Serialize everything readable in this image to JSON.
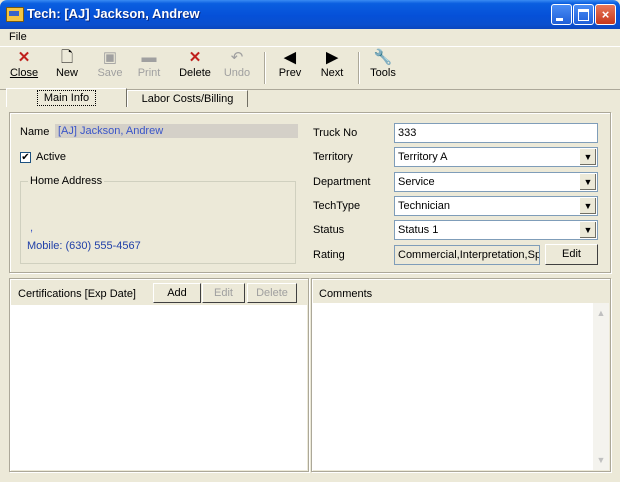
{
  "window": {
    "title": "Tech: [AJ] Jackson, Andrew",
    "caption_buttons": {
      "minimize": "minimize-icon",
      "maximize": "maximize-icon",
      "close": "×"
    }
  },
  "menu": {
    "file": "File"
  },
  "toolbar": {
    "close": {
      "label": "Close",
      "icon": "x-icon",
      "color": "#C0201C",
      "enabled": true
    },
    "new": {
      "label": "New",
      "icon": "document-icon",
      "enabled": true
    },
    "save": {
      "label": "Save",
      "icon": "floppy-icon",
      "enabled": false
    },
    "print": {
      "label": "Print",
      "icon": "printer-icon",
      "enabled": false
    },
    "delete": {
      "label": "Delete",
      "icon": "x-icon",
      "color": "#C0201C",
      "enabled": true
    },
    "undo": {
      "label": "Undo",
      "icon": "undo-icon",
      "enabled": false
    },
    "prev": {
      "label": "Prev",
      "icon": "triangle-left-icon",
      "enabled": true
    },
    "next": {
      "label": "Next",
      "icon": "triangle-right-icon",
      "enabled": true
    },
    "tools": {
      "label": "Tools",
      "icon": "wrench-icon",
      "enabled": true
    }
  },
  "tabs": [
    {
      "label": "Main Info",
      "active": true
    },
    {
      "label": "Labor Costs/Billing",
      "active": false
    }
  ],
  "main": {
    "name_label": "Name",
    "name_value": "[AJ] Jackson, Andrew",
    "active_label": "Active",
    "active_checked": true,
    "check_mark": "✔",
    "home_address_label": "Home Address",
    "address_dot": ",",
    "mobile": "Mobile: (630) 555-4567",
    "truck_label": "Truck No",
    "truck_value": "333",
    "territory_label": "Territory",
    "territory_value": "Territory A",
    "department_label": "Department",
    "department_value": "Service",
    "techtype_label": "TechType",
    "techtype_value": "Technician",
    "status_label": "Status",
    "status_value": "Status 1",
    "rating_label": "Rating",
    "rating_value": "Commercial,Interpretation,Spa",
    "rating_edit": "Edit",
    "dropdown_arrow": "▼"
  },
  "certifications": {
    "header": "Certifications [Exp Date]",
    "add": "Add",
    "edit": "Edit",
    "delete": "Delete"
  },
  "comments": {
    "header": "Comments",
    "scroll_up": "▲",
    "scroll_down": "▼"
  }
}
